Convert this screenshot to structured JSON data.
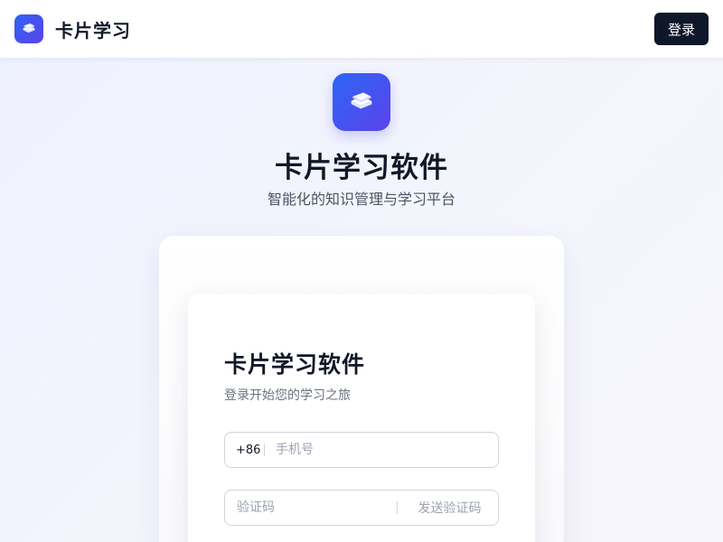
{
  "header": {
    "logo_icon": "book-stack-icon",
    "brand": "卡片学习",
    "login_label": "登录"
  },
  "hero": {
    "logo_icon": "book-stack-icon",
    "title": "卡片学习软件",
    "subtitle": "智能化的知识管理与学习平台"
  },
  "form": {
    "title": "卡片学习软件",
    "subtitle": "登录开始您的学习之旅",
    "country_code": "+86",
    "phone_placeholder": "手机号",
    "code_placeholder": "验证码",
    "send_code_label": "发送验证码"
  },
  "colors": {
    "brand_gradient_start": "#2f63f5",
    "brand_gradient_end": "#5b43ea",
    "login_button": "#0f172a"
  }
}
